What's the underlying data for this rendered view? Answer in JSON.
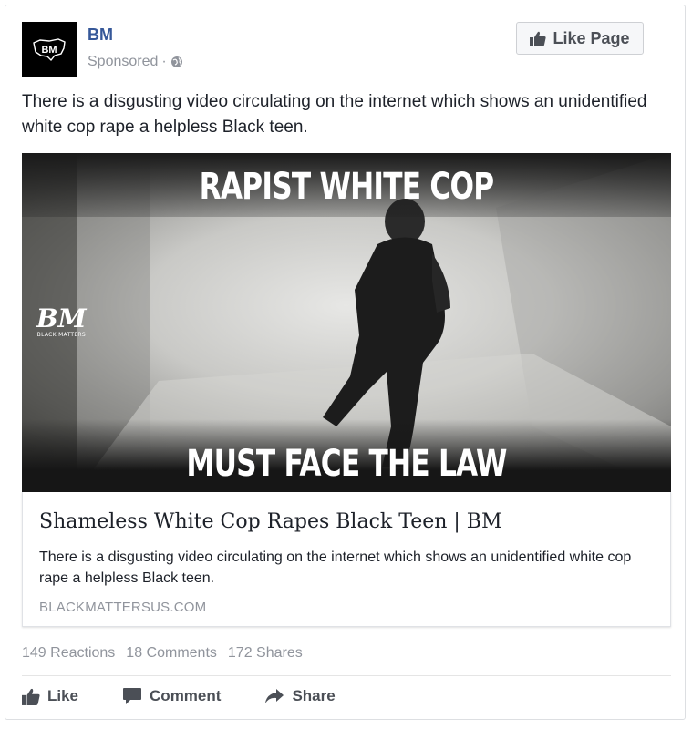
{
  "page": {
    "avatar_text": "BM",
    "name": "BM",
    "sponsored_label": "Sponsored",
    "sponsored_separator": "·",
    "like_page_label": "Like Page"
  },
  "post": {
    "text": "There is a disgusting video circulating on the internet which shows an unidentified white cop rape a helpless Black teen."
  },
  "media": {
    "headline_top": "RAPIST WHITE COP",
    "headline_bottom": "MUST FACE THE LAW",
    "watermark_logo": "BM",
    "watermark_sub": "BLACK MATTERS"
  },
  "link": {
    "title": "Shameless White Cop Rapes Black Teen | BM",
    "description": "There is a disgusting video circulating on the internet which shows an unidentified white cop rape a helpless Black teen.",
    "domain": "BLACKMATTERSUS.COM"
  },
  "stats": {
    "reactions": "149 Reactions",
    "comments": "18 Comments",
    "shares": "172 Shares"
  },
  "actions": {
    "like": "Like",
    "comment": "Comment",
    "share": "Share"
  },
  "colors": {
    "link_blue": "#365899",
    "muted": "#90949c",
    "action_gray": "#4b4f56"
  },
  "icons": [
    "globe-icon",
    "thumbs-up-icon",
    "comment-icon",
    "share-icon"
  ]
}
